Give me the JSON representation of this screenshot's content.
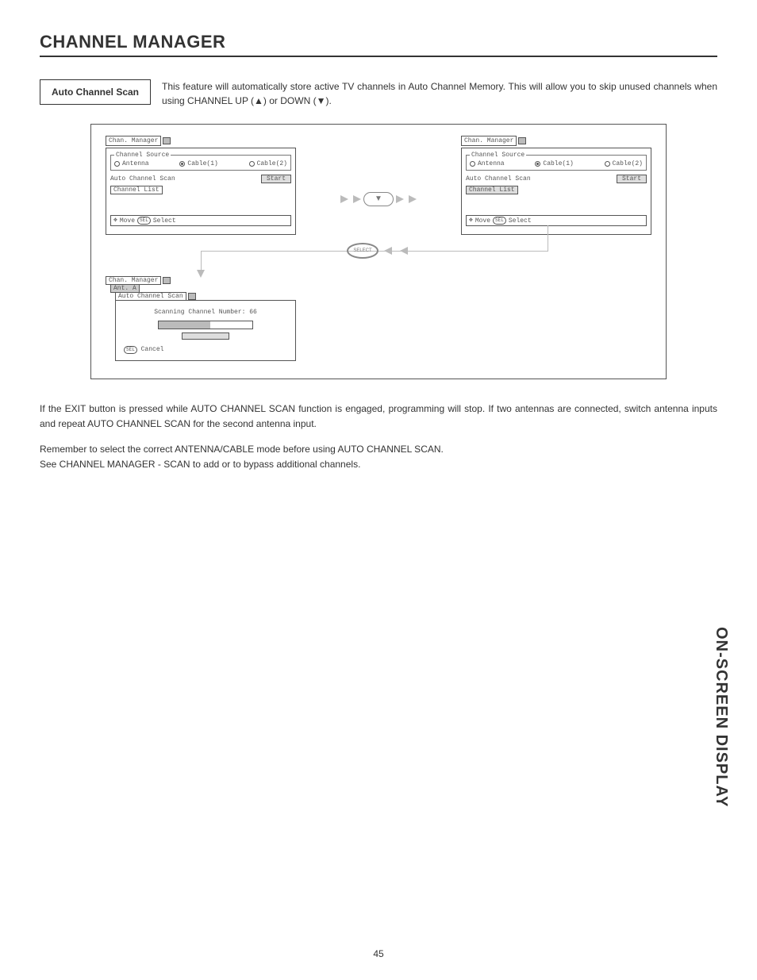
{
  "page": {
    "title": "CHANNEL MANAGER",
    "number": "45",
    "side_label": "ON-SCREEN DISPLAY"
  },
  "section": {
    "box_label": "Auto Channel Scan",
    "intro": "This feature will automatically store active TV channels in Auto Channel Memory.  This will allow you to skip unused channels when using CHANNEL UP (▲) or DOWN (▼)."
  },
  "osd": {
    "title": "Chan. Manager",
    "source_legend": "Channel Source",
    "sources": {
      "antenna": "Antenna",
      "cable1": "Cable(1)",
      "cable2": "Cable(2)"
    },
    "auto_scan_label": "Auto Channel Scan",
    "start_label": "Start",
    "channel_list_label": "Channel List",
    "hint_move": "Move",
    "hint_select": "Select",
    "sel_tag": "SEL"
  },
  "osd_left": {
    "selected_source": "cable1",
    "highlight": "start"
  },
  "osd_right": {
    "selected_source": "cable1",
    "highlight": "channel_list"
  },
  "remote": {
    "down_key": "▼",
    "select_key": "SELECT"
  },
  "scan_osd": {
    "tab1": "Chan. Manager",
    "tab2": "Ant. A",
    "tab3": "Auto Channel Scan",
    "message": "Scanning Channel Number: 66",
    "cancel": "Cancel",
    "sel_tag": "SEL"
  },
  "body": {
    "p1": "If the EXIT button is pressed while AUTO CHANNEL SCAN function is engaged, programming will stop.  If two antennas are connected, switch antenna inputs and repeat AUTO CHANNEL SCAN for the second antenna input.",
    "p2a": "Remember to select the correct ANTENNA/CABLE mode before using AUTO CHANNEL SCAN.",
    "p2b": "See CHANNEL MANAGER - SCAN to add or to bypass additional channels."
  }
}
